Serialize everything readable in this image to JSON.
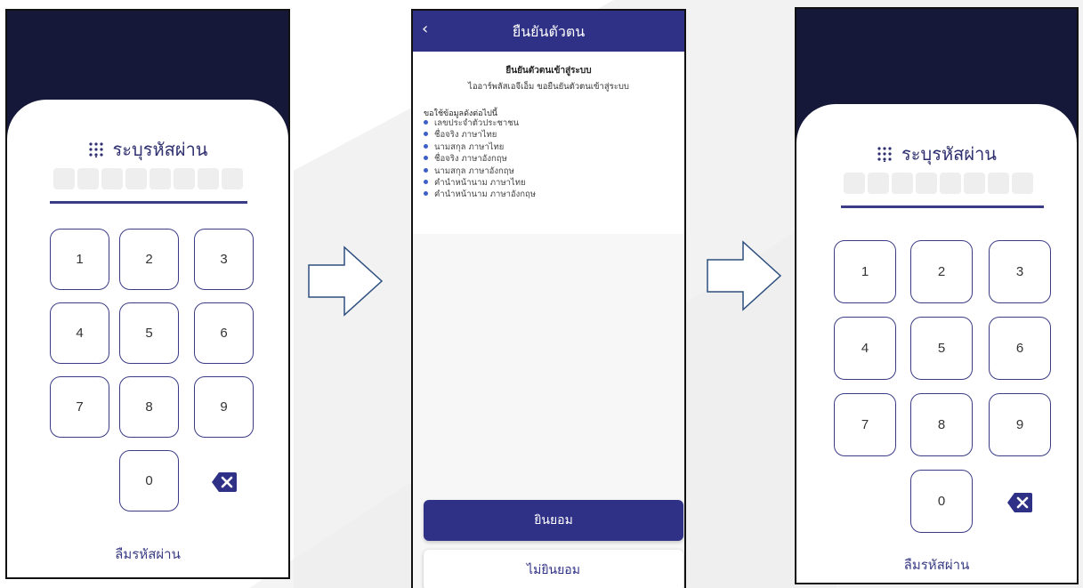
{
  "pin_screen": {
    "title": "ระบุรหัสผ่าน",
    "keys": [
      "1",
      "2",
      "3",
      "4",
      "5",
      "6",
      "7",
      "8",
      "9",
      "0"
    ],
    "forgot_label": "ลืมรหัสผ่าน",
    "pin_length": 8
  },
  "consent_screen": {
    "back_label": "‹",
    "header_title": "ยืนยันตัวตน",
    "heading": "ยืนยันตัวตนเข้าสู่ระบบ",
    "subheading": "ไออาร์พลัสเอจีเอ็ม ขอยืนยันตัวตนเข้าสู่ระบบ",
    "request_label": "ขอใช้ข้อมูลดังต่อไปนี้",
    "items": [
      "เลขประจำตัวประชาชน",
      "ชื่อจริง ภาษาไทย",
      "นามสกุล ภาษาไทย",
      "ชื่อจริง ภาษาอังกฤษ",
      "นามสกุล ภาษาอังกฤษ",
      "คำนำหน้านาม ภาษาไทย",
      "คำนำหน้านาม ภาษาอังกฤษ"
    ],
    "accept_label": "ยินยอม",
    "decline_label": "ไม่ยินยอม"
  },
  "colors": {
    "primary": "#2f3186",
    "dark_bg": "#16183a",
    "bullet": "#3d5fc8"
  }
}
